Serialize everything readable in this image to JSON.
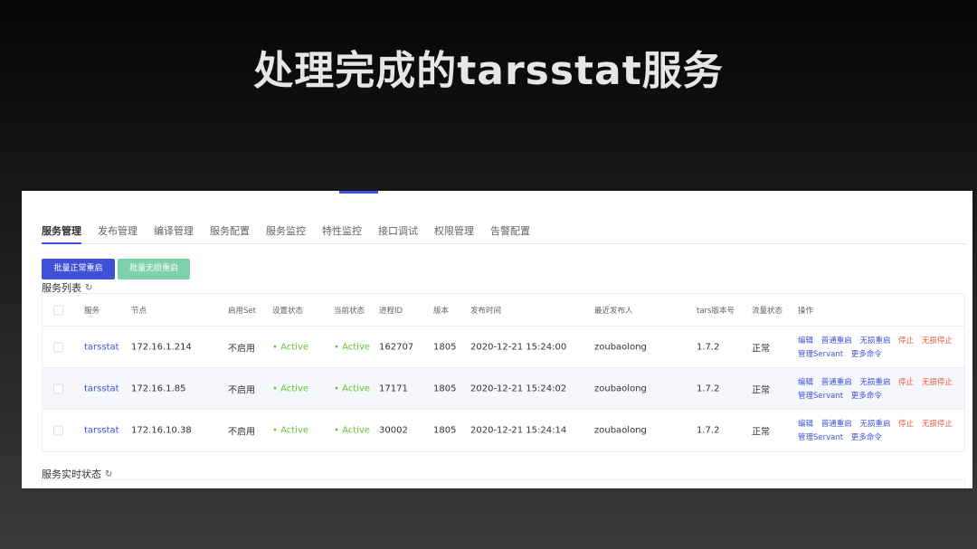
{
  "slide": {
    "title": "处理完成的tarsstat服务"
  },
  "tabs": [
    "服务管理",
    "发布管理",
    "编译管理",
    "服务配置",
    "服务监控",
    "特性监控",
    "接口调试",
    "权限管理",
    "告警配置"
  ],
  "buttons": {
    "restart": "批量正常重启",
    "smooth_restart": "批量无损重启"
  },
  "service_list": {
    "label": "服务列表",
    "refresh_icon": "refresh-icon"
  },
  "realtime": {
    "label": "服务实时状态",
    "refresh_icon": "refresh-icon"
  },
  "table": {
    "headers": {
      "service": "服务",
      "node": "节点",
      "enable_set": "启用Set",
      "setting_state": "设置状态",
      "current_state": "当前状态",
      "pid": "进程ID",
      "version": "版本",
      "publish_time": "发布时间",
      "publisher": "最近发布人",
      "tars_version": "tars版本号",
      "flow_state": "流量状态",
      "ops": "操作"
    },
    "rows": [
      {
        "service": "tarsstat",
        "node": "172.16.1.214",
        "enable_set": "不启用",
        "setting_state": "• Active",
        "current_state": "• Active",
        "pid": "162707",
        "version": "1805",
        "publish_time": "2020-12-21 15:24:00",
        "publisher": "zoubaolong",
        "tars_version": "1.7.2",
        "flow_state": "正常"
      },
      {
        "service": "tarsstat",
        "node": "172.16.1.85",
        "enable_set": "不启用",
        "setting_state": "• Active",
        "current_state": "• Active",
        "pid": "17171",
        "version": "1805",
        "publish_time": "2020-12-21 15:24:02",
        "publisher": "zoubaolong",
        "tars_version": "1.7.2",
        "flow_state": "正常"
      },
      {
        "service": "tarsstat",
        "node": "172.16.10.38",
        "enable_set": "不启用",
        "setting_state": "• Active",
        "current_state": "• Active",
        "pid": "30002",
        "version": "1805",
        "publish_time": "2020-12-21 15:24:14",
        "publisher": "zoubaolong",
        "tars_version": "1.7.2",
        "flow_state": "正常"
      }
    ],
    "ops": {
      "edit": "编辑",
      "normal_restart": "普通重启",
      "smooth_restart": "无损重启",
      "stop": "停止",
      "smooth_stop": "无损停止",
      "manage_servant": "管理Servant",
      "more": "更多命令"
    }
  },
  "colors": {
    "accent": "#3f51d6",
    "success": "#67c23a",
    "danger": "#e8573e",
    "green_button": "#7fd1a9"
  }
}
